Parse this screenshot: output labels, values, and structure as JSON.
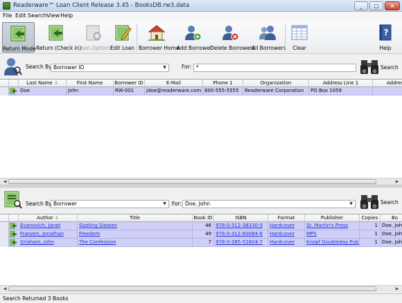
{
  "window": {
    "title": "Readerware™ Loan Client Release 3.45 - BooksDB.rw3.data"
  },
  "menu": [
    "File",
    "Edit",
    "Search",
    "View",
    "Help"
  ],
  "toolbar": {
    "buttons": [
      {
        "label": "Return Mode",
        "icon": "return-mode-icon",
        "state": "active"
      },
      {
        "label": "Return (Check in)",
        "icon": "return-checkin-icon"
      },
      {
        "label": "Loan Options",
        "icon": "loan-options-icon",
        "state": "disabled"
      },
      {
        "label": "Edit Loan",
        "icon": "edit-loan-icon"
      },
      {
        "label": "Borrower Home",
        "icon": "home-icon"
      },
      {
        "label": "Add Borrower",
        "icon": "add-borrower-icon"
      },
      {
        "label": "Delete Borrowers",
        "icon": "delete-borrower-icon"
      },
      {
        "label": "All Borrowers",
        "icon": "all-borrowers-icon"
      },
      {
        "label": "Clear",
        "icon": "clear-grid-icon"
      },
      {
        "label": "Help",
        "icon": "help-book-icon"
      }
    ]
  },
  "borrower_panel": {
    "search_by_label": "Search By:",
    "search_by_value": "Borrower ID",
    "for_label": "For:",
    "for_value": "*",
    "search_button": "Search",
    "columns": [
      "Last Name",
      "First Name",
      "Borrower ID",
      "E-Mail",
      "Phone 1",
      "Organization",
      "Address Line 1",
      "Addres"
    ],
    "rows": [
      [
        "Doe",
        "John",
        "RW-001",
        "jdoe@readerware.com",
        "800-555-5555",
        "Readerware Corporation",
        "PO Box 1059",
        ""
      ]
    ]
  },
  "loans_panel": {
    "search_by_label": "Search By:",
    "search_by_value": "Borrower",
    "for_label": "For:",
    "for_value": "Doe, John",
    "search_button": "Search",
    "columns": [
      "Author",
      "Title",
      "Book ID",
      "ISBN",
      "Format",
      "Publisher",
      "Copies",
      "Bo"
    ],
    "rows": [
      [
        "Evanovich, Janet",
        "Sizzling Sixteen",
        "46",
        "978-0-312-38330-5",
        "Hardcover",
        "St. Martin's Press",
        "1",
        "Doe, Joh"
      ],
      [
        "Franzen, Jonathan",
        "Freedom",
        "49",
        "978-0-312-60084-6",
        "Hardcover",
        "MPS",
        "1",
        "Doe, Joh"
      ],
      [
        "Grisham, John",
        "The Confession",
        "7",
        "978-0-385-52804-7",
        "Hardcover",
        "Knopf Doubleday Publis...",
        "1",
        "Doe, Joh"
      ]
    ]
  },
  "status": {
    "text": "Search Returned 3 Books"
  },
  "colors": {
    "row_highlight": "#cfcff7",
    "link": "#1f2fd6",
    "selection": "#3874d8"
  }
}
